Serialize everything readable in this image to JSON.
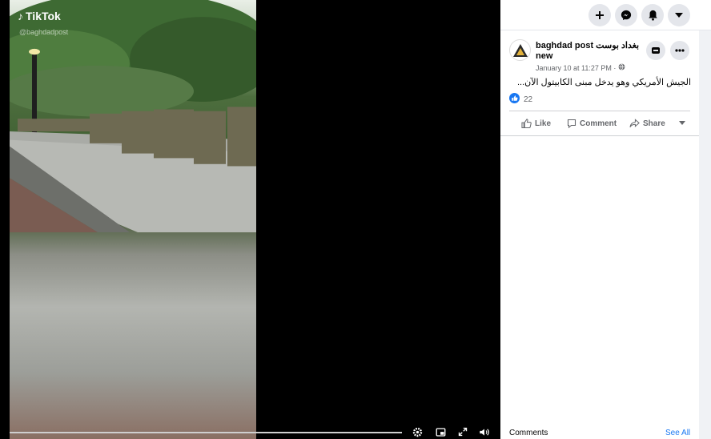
{
  "video": {
    "watermark": "TikTok",
    "watermark_handle": "@baghdadpost",
    "controls": {
      "settings_icon": "gear-icon",
      "pip_icon": "picture-in-picture-icon",
      "fullscreen_icon": "expand-icon",
      "volume_icon": "speaker-icon"
    }
  },
  "topbar": {
    "icons": [
      "plus-icon",
      "messenger-icon",
      "bell-icon",
      "caret-down-icon"
    ]
  },
  "post": {
    "page_name": "baghdad post بغداد بوست new",
    "timestamp": "January 10 at 11:27 PM ·",
    "audience_icon": "globe-icon",
    "text": "الجيش الأمريكي وهو يدخل مبنى الكابيتول الآن...",
    "reaction_icon": "like-icon",
    "reaction_count": "22",
    "actions": {
      "like": "Like",
      "comment": "Comment",
      "share": "Share"
    }
  },
  "footer": {
    "comments_label": "Comments",
    "see_all_label": "See All"
  },
  "colors": {
    "accent": "#1877f2",
    "muted": "#65676b",
    "chip": "#e4e6eb"
  }
}
